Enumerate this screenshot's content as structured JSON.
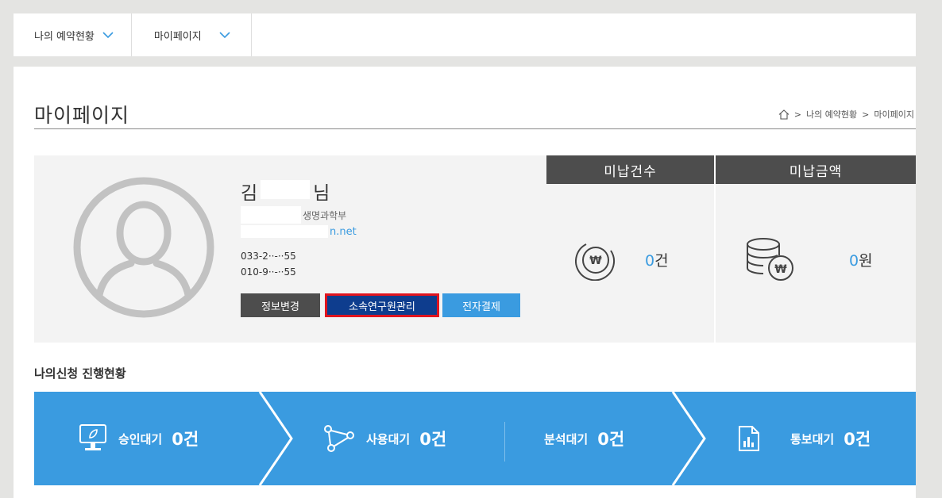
{
  "nav": {
    "items": [
      {
        "label": "나의 예약현황"
      },
      {
        "label": "마이페이지"
      }
    ]
  },
  "page": {
    "title": "마이페이지",
    "breadcrumb": [
      "나의 예약현황",
      "마이페이지"
    ]
  },
  "profile": {
    "name_first": "김",
    "name_suffix": "님",
    "department": "생명과학부",
    "email_visible": "n.net",
    "phone1": "033-2··-··55",
    "phone2": "010-9··-··55",
    "buttons": {
      "info": "정보변경",
      "members": "소속연구원관리",
      "payment": "전자결제"
    }
  },
  "stats": {
    "unpaid_count": {
      "label": "미납건수",
      "value": "0",
      "unit": "건"
    },
    "unpaid_amount": {
      "label": "미납금액",
      "value": "0",
      "unit": "원"
    }
  },
  "progress": {
    "title": "나의신청 진행현황",
    "steps": [
      {
        "label": "승인대기",
        "count": "0건",
        "icon": "monitor-icon"
      },
      {
        "label": "사용대기",
        "count": "0건",
        "icon": "nodes-icon"
      },
      {
        "label": "분석대기",
        "count": "0건",
        "icon": ""
      },
      {
        "label": "통보대기",
        "count": "0건",
        "icon": "report-chart-icon"
      }
    ]
  },
  "colors": {
    "accent": "#3a9be0",
    "dark": "#4d4d4d",
    "highlight_button": "#0e3d8e",
    "highlight_border": "#e0141e"
  }
}
